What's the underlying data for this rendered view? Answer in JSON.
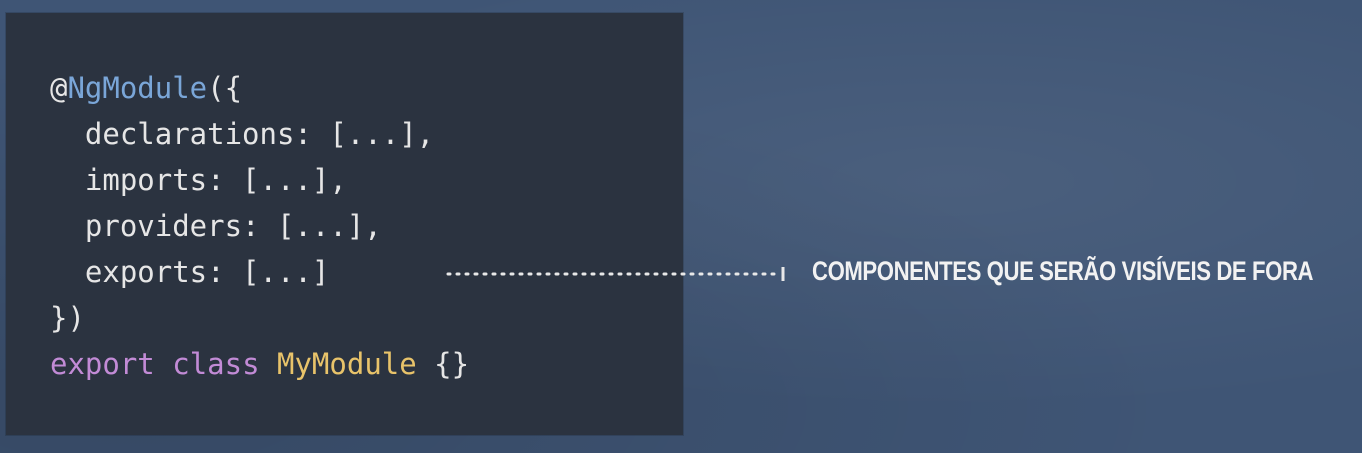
{
  "code": {
    "lines": [
      [
        {
          "t": "@",
          "c": "tok-at"
        },
        {
          "t": "NgModule",
          "c": "tok-deco"
        },
        {
          "t": "({",
          "c": "tok-plain"
        }
      ],
      [
        {
          "t": "  declarations: [...],",
          "c": "tok-plain"
        }
      ],
      [
        {
          "t": "  imports: [...],",
          "c": "tok-plain"
        }
      ],
      [
        {
          "t": "  providers: [...],",
          "c": "tok-plain"
        }
      ],
      [
        {
          "t": "  exports: [...]",
          "c": "tok-plain"
        }
      ],
      [
        {
          "t": "})",
          "c": "tok-plain"
        }
      ],
      [
        {
          "t": "export",
          "c": "tok-kw"
        },
        {
          "t": " ",
          "c": "tok-plain"
        },
        {
          "t": "class",
          "c": "tok-kw"
        },
        {
          "t": " ",
          "c": "tok-plain"
        },
        {
          "t": "MyModule",
          "c": "tok-cls"
        },
        {
          "t": " {}",
          "c": "tok-plain"
        }
      ]
    ]
  },
  "annotation": {
    "text": "COMPONENTES QUE SERÃO VISÍVEIS DE FORA"
  },
  "colors": {
    "background": "#3f5575",
    "code_panel": "#2b3340",
    "decorator": "#7aa6d8",
    "keyword": "#c28bd6",
    "class_name": "#e8c36a",
    "text": "#e6e6e6"
  }
}
